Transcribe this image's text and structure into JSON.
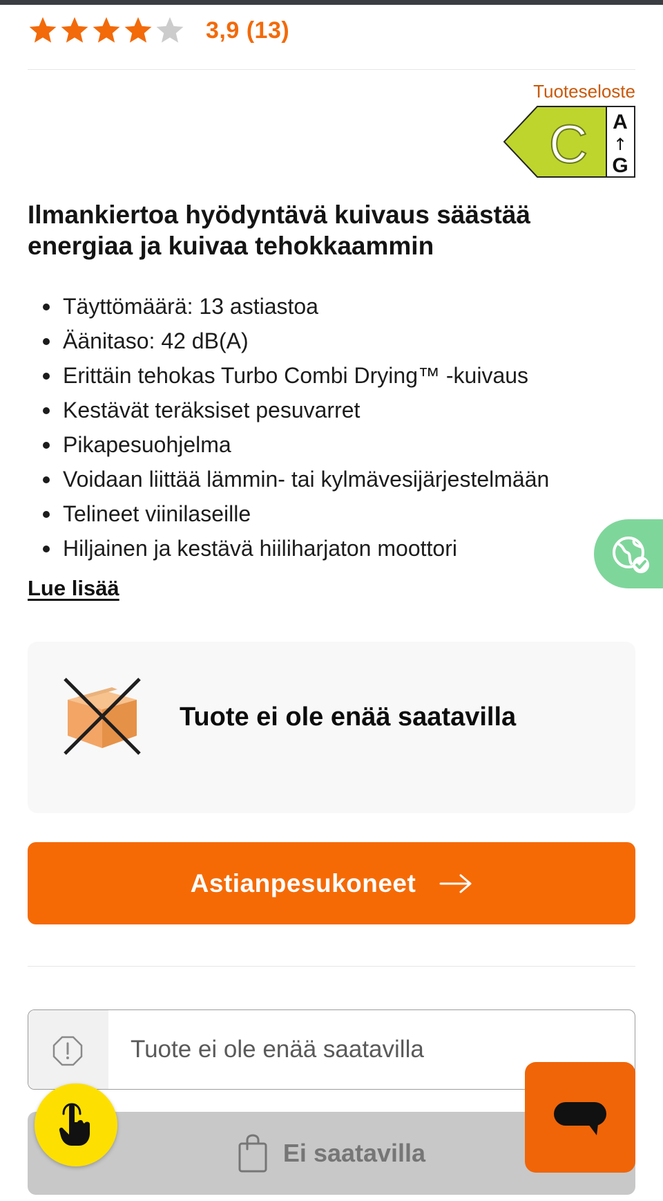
{
  "rating": {
    "stars_filled": 4,
    "stars_total": 5,
    "text": "3,9 (13)",
    "star_color": "#f26a0a",
    "star_empty_color": "#cccccc"
  },
  "energy": {
    "link_label": "Tuoteseloste",
    "class": "C",
    "scale_top": "A",
    "scale_arrow": "↑",
    "scale_bottom": "G",
    "class_color": "#bed52e"
  },
  "product": {
    "headline": "Ilmankiertoa hyödyntävä kuivaus säästää energiaa ja kuivaa tehokkaammin",
    "features": [
      "Täyttömäärä: 13 astiastoa",
      "Äänitaso: 42 dB(A)",
      "Erittäin tehokas Turbo Combi Drying™ -kuivaus",
      "Kestävät teräksiset pesuvarret",
      "Pikapesuohjelma",
      "Voidaan liittää lämmin- tai kylmävesijärjestelmään",
      "Telineet viinilaseille",
      "Hiljainen ja kestävä hiiliharjaton moottori"
    ],
    "read_more": "Lue lisää"
  },
  "availability": {
    "message": "Tuote ei ole enää saatavilla",
    "icon": "crossed-box-icon"
  },
  "category_button": {
    "label": "Astianpesukoneet",
    "icon": "arrow-right-icon"
  },
  "stock_status": {
    "text": "Tuote ei ole enää saatavilla",
    "icon": "alert-octagon-icon"
  },
  "add_to_cart": {
    "label": "Ei saatavilla",
    "icon": "shopping-bag-icon"
  },
  "floating": {
    "eco_icon": "globe-check-icon",
    "accessibility_icon": "hand-pointer-icon",
    "chat_icon": "chat-bubble-icon"
  },
  "colors": {
    "accent": "#f56a05",
    "eco": "#7fd69b",
    "accessibility": "#fde001"
  }
}
